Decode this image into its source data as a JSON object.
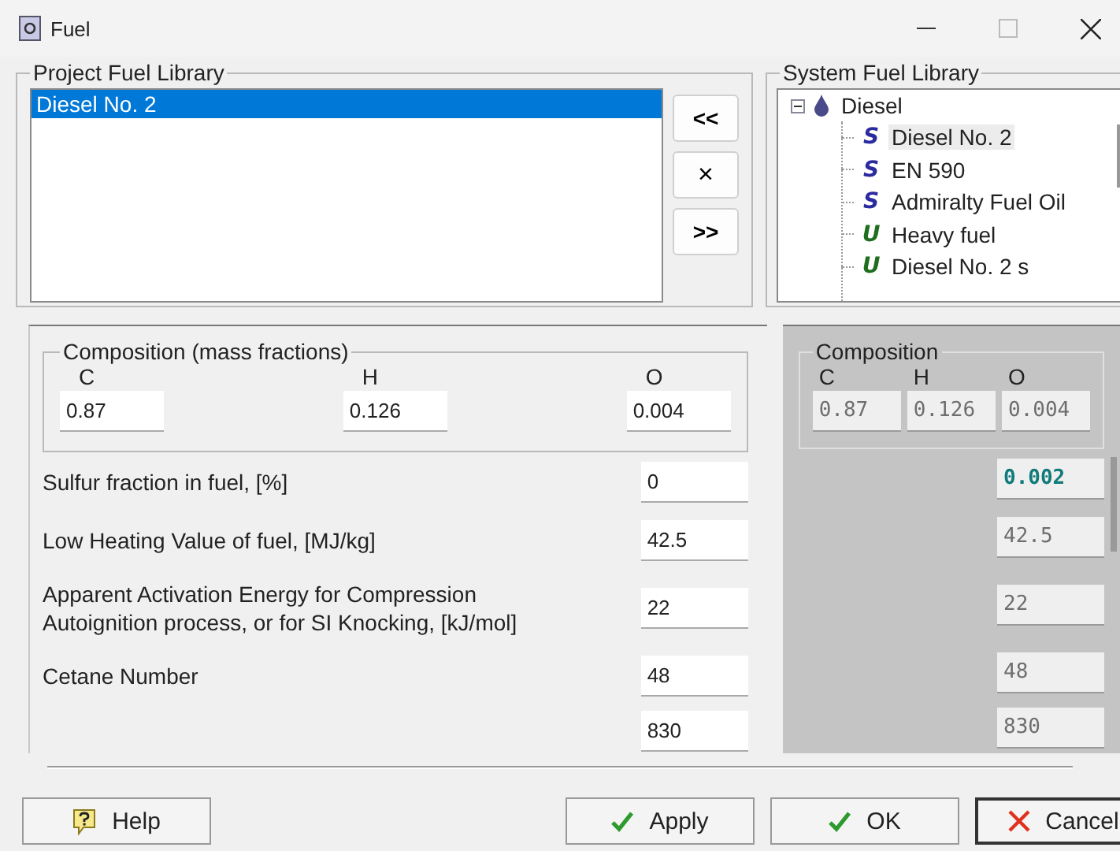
{
  "window": {
    "title": "Fuel"
  },
  "project_library": {
    "title": "Project Fuel Library",
    "items": [
      {
        "label": "Diesel No. 2",
        "selected": true
      }
    ]
  },
  "transfer_buttons": [
    "<<",
    "×",
    ">>"
  ],
  "system_library": {
    "title": "System Fuel Library",
    "tree": [
      {
        "label": "Diesel",
        "expanded": true,
        "children": [
          {
            "label": "Diesel No. 2",
            "badge": "S",
            "kind": "system",
            "selected": true
          },
          {
            "label": "EN 590",
            "badge": "S",
            "kind": "system",
            "selected": false
          },
          {
            "label": "Admiralty Fuel Oil",
            "badge": "S",
            "kind": "system",
            "selected": false
          },
          {
            "label": "Heavy fuel",
            "badge": "U",
            "kind": "user",
            "selected": false
          },
          {
            "label": "Diesel No. 2 s",
            "badge": "U",
            "kind": "user",
            "selected": false
          }
        ]
      }
    ]
  },
  "composition": {
    "title": "Composition (mass fractions)",
    "fields": [
      {
        "label": "C",
        "value": "0.87"
      },
      {
        "label": "H",
        "value": "0.126"
      },
      {
        "label": "O",
        "value": "0.004"
      }
    ]
  },
  "properties": [
    {
      "label": "Sulfur fraction in fuel, [%]",
      "value": "0"
    },
    {
      "label": "Low Heating Value of fuel, [MJ/kg]",
      "value": "42.5"
    },
    {
      "label": "Apparent Activation Energy for Compression Autoignition process, or for SI Knocking, [kJ/mol]",
      "value": "22"
    },
    {
      "label": "Cetane Number",
      "value": "48"
    },
    {
      "value": "830"
    }
  ],
  "system_composition": {
    "title": "Composition",
    "fields": [
      {
        "label": "C",
        "value": "0.87"
      },
      {
        "label": "H",
        "value": "0.126"
      },
      {
        "label": "O",
        "value": "0.004"
      }
    ]
  },
  "system_properties": [
    {
      "value": "0.002",
      "highlighted": true
    },
    {
      "value": "42.5",
      "highlighted": false
    },
    {
      "value": "22",
      "highlighted": false
    },
    {
      "value": "48",
      "highlighted": false
    },
    {
      "value": "830",
      "highlighted": false
    }
  ],
  "buttons": [
    {
      "label": "Help",
      "kind": "help",
      "default": false
    },
    {
      "label": "Apply",
      "kind": "apply",
      "default": false
    },
    {
      "label": "OK",
      "kind": "ok",
      "default": false
    },
    {
      "label": "Cancel",
      "kind": "cancel",
      "default": true
    }
  ]
}
